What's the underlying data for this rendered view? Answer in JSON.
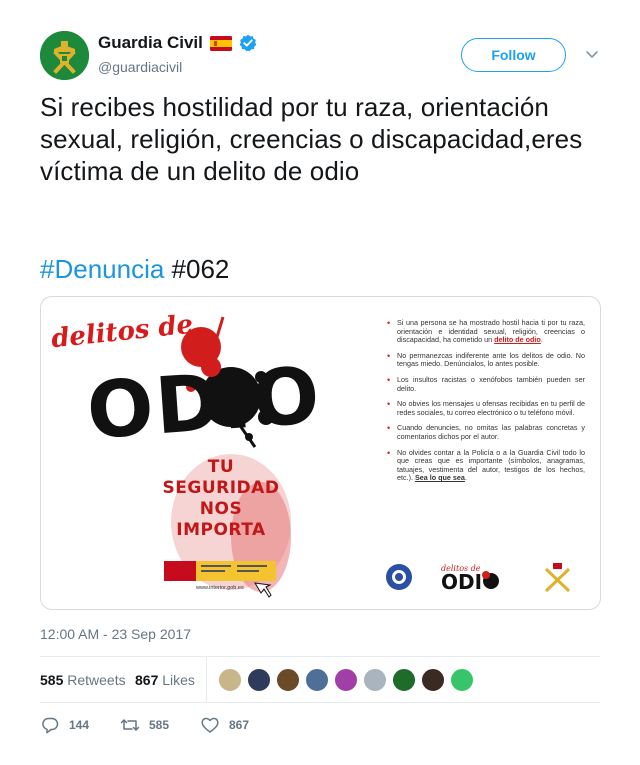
{
  "author": {
    "display_name": "Guardia Civil",
    "handle": "@guardiacivil",
    "verified": true,
    "flag": "es-flag-icon"
  },
  "follow_label": "Follow",
  "tweet": {
    "text": "Si recibes hostilidad por tu raza, orientación sexual, religión, creencias o discapacidad,eres víctima de un delito de odio",
    "hashtag": "#Denuncia",
    "tag_number": "#062"
  },
  "media": {
    "poster_title_small": "delitos de",
    "poster_title_big": "ODIO",
    "slogan": [
      "TU",
      "SEGURIDAD",
      "NOS",
      "IMPORTA"
    ],
    "url": "www.interior.gob.es",
    "bullets": [
      {
        "pre": "Si una persona se ha mostrado hostil hacia ti por tu raza, orientación e identidad sexual, religión, creencias o discapacidad, ha cometido un ",
        "em": "delito de odio",
        "post": "."
      },
      {
        "pre": "No permanezcas indiferente ante los delitos de odio. No tengas miedo. Denúncialos, lo antes posible.",
        "em": "",
        "post": ""
      },
      {
        "pre": "Los insultos racistas o xenófobos también pueden ser delito.",
        "em": "",
        "post": ""
      },
      {
        "pre": "No obvies los mensajes u ofensas recibidas en tu perfil de redes sociales, tu correo electrónico o tu teléfono móvil.",
        "em": "",
        "post": ""
      },
      {
        "pre": "Cuando denuncies, no omitas las palabras concretas y comentarios dichos por el autor.",
        "em": "",
        "post": ""
      },
      {
        "pre": "No olvides contar a la Policía o a la Guardia Civil todo lo que creas que es importante (símbolos, anagramas, tatuajes, vestimenta del autor, testigos de los hechos, etc.). ",
        "em": "Sea lo que sea",
        "post": "."
      }
    ]
  },
  "timestamp": "12:00 AM - 23 Sep 2017",
  "stats": {
    "retweets_count": "585",
    "retweets_label": "Retweets",
    "likes_count": "867",
    "likes_label": "Likes"
  },
  "likers": [
    "#c9b58a",
    "#2f3b5a",
    "#6b4a2a",
    "#4f6f96",
    "#a23fa6",
    "#aab4be",
    "#1f6b2a",
    "#3a2a22",
    "#37c46b"
  ],
  "actions": {
    "replies": "144",
    "retweets": "585",
    "likes": "867"
  },
  "colors": {
    "link": "#1b95e0",
    "follow": "#1da1f2",
    "muted": "#657786",
    "poster_red": "#d21d1d"
  }
}
